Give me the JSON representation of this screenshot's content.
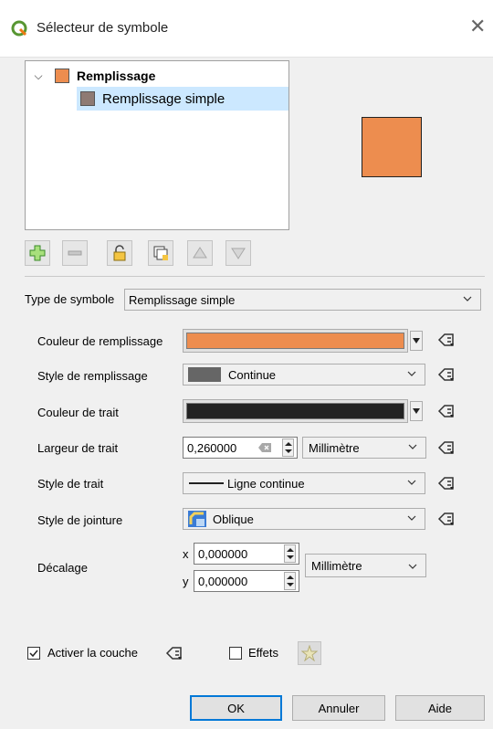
{
  "window": {
    "title": "Sélecteur de symbole",
    "app_icon": "qgis-icon",
    "close_icon": "close-icon"
  },
  "layers": {
    "root": {
      "label": "Remplissage",
      "swatch_color": "#ED8D4F"
    },
    "child": {
      "label": "Remplissage simple",
      "swatch_color": "#8E7A73",
      "selected": true
    }
  },
  "preview": {
    "fill_color": "#ED8D4F",
    "stroke_color": "#1F1F1F"
  },
  "toolbar": {
    "add": "add-layer-icon",
    "remove": "remove-layer-icon",
    "lock": "lock-icon",
    "duplicate": "duplicate-icon",
    "up": "move-up-icon",
    "down": "move-down-icon"
  },
  "symbol_type": {
    "label": "Type de symbole",
    "value": "Remplissage simple"
  },
  "properties": {
    "fill_color": {
      "label": "Couleur de remplissage",
      "color": "#ED8D4F"
    },
    "fill_style": {
      "label": "Style de remplissage",
      "value": "Continue"
    },
    "stroke_color": {
      "label": "Couleur de trait",
      "color": "#222222"
    },
    "stroke_width": {
      "label": "Largeur de trait",
      "value": "0,260000",
      "unit": "Millimètre"
    },
    "stroke_style": {
      "label": "Style de trait",
      "value": "Ligne continue"
    },
    "join_style": {
      "label": "Style de jointure",
      "value": "Oblique"
    },
    "offset": {
      "label": "Décalage",
      "x_label": "x",
      "x": "0,000000",
      "y_label": "y",
      "y": "0,000000",
      "unit": "Millimètre"
    }
  },
  "footer": {
    "enable_layer": {
      "label": "Activer la couche",
      "checked": true
    },
    "effects": {
      "label": "Effets",
      "checked": false
    }
  },
  "buttons": {
    "ok": "OK",
    "cancel": "Annuler",
    "help": "Aide"
  }
}
